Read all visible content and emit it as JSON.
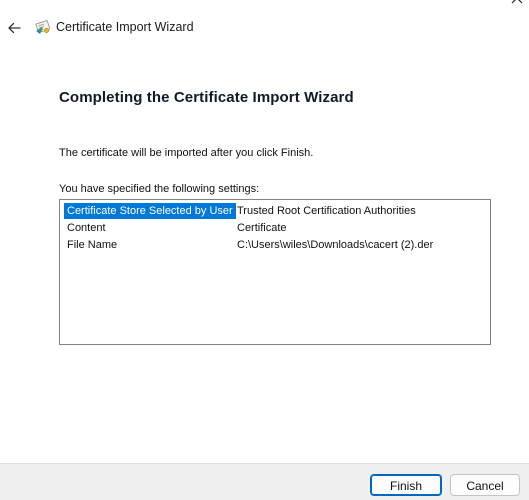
{
  "window": {
    "title": "Certificate Import Wizard"
  },
  "icons": {
    "back": "back-arrow-icon",
    "wizard": "certificate-wizard-icon",
    "close": "close-icon"
  },
  "page": {
    "heading": "Completing the Certificate Import Wizard",
    "info": "The certificate will be imported after you click Finish.",
    "settings_label": "You have specified the following settings:"
  },
  "settings": [
    {
      "key": "Certificate Store Selected by User",
      "value": "Trusted Root Certification Authorities",
      "selected": true
    },
    {
      "key": "Content",
      "value": "Certificate",
      "selected": false
    },
    {
      "key": "File Name",
      "value": "C:\\Users\\wiles\\Downloads\\cacert (2).der",
      "selected": false
    }
  ],
  "footer": {
    "finish_label": "Finish",
    "cancel_label": "Cancel"
  },
  "colors": {
    "selection": "#0078d7",
    "accent_border": "#0067c0",
    "footer_bg": "#f0f0f0"
  }
}
